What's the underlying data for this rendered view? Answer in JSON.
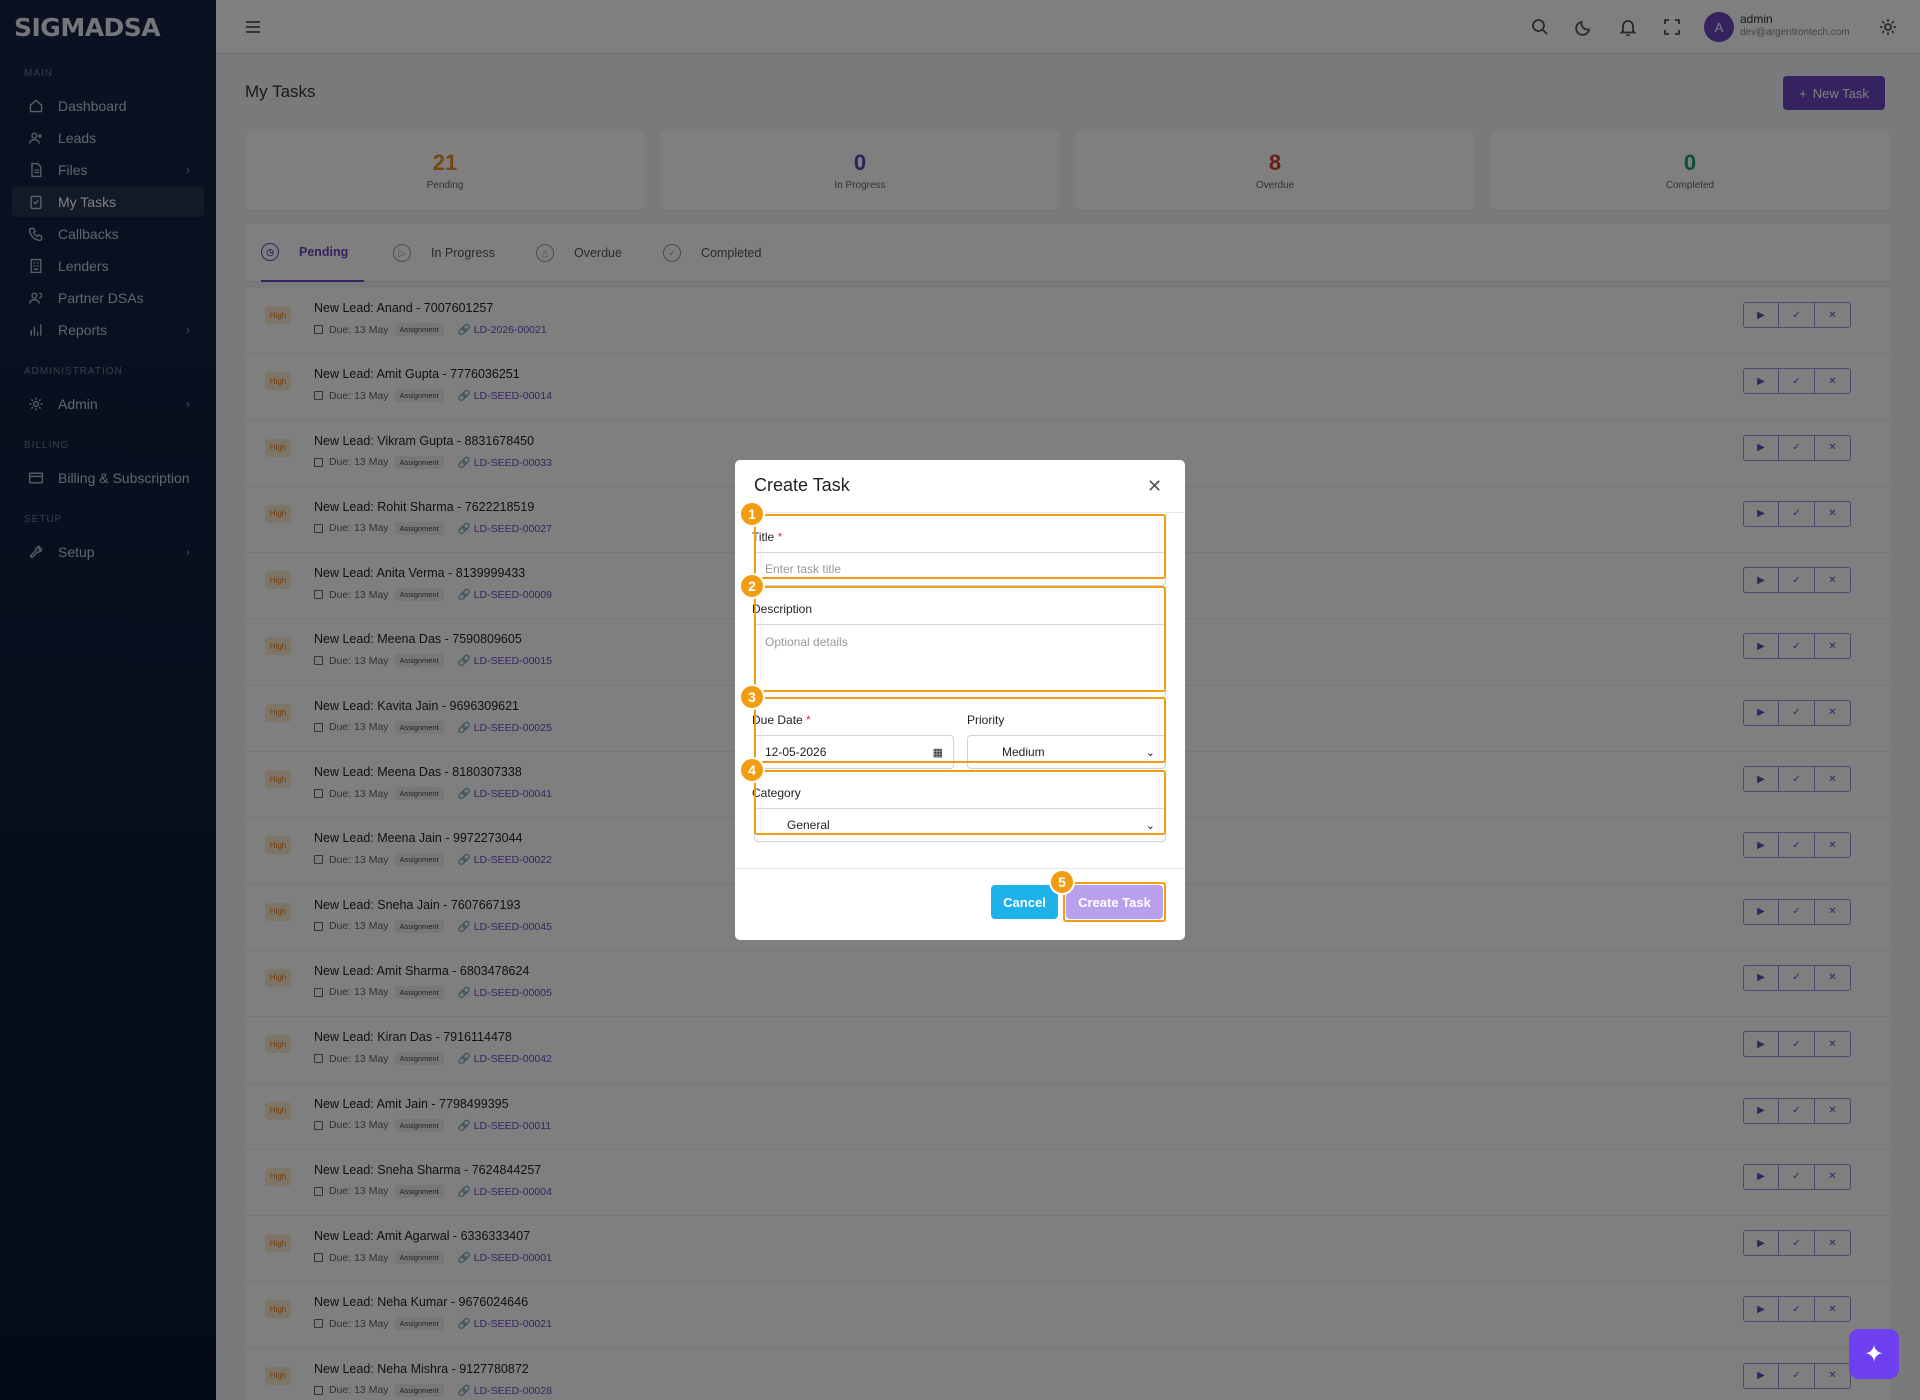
{
  "brand": {
    "logo": "SIGMADSA"
  },
  "sidebar": {
    "sections": [
      {
        "title": "MAIN",
        "items": [
          {
            "label": "Dashboard",
            "icon": "home-icon"
          },
          {
            "label": "Leads",
            "icon": "user-plus-icon"
          },
          {
            "label": "Files",
            "icon": "file-icon",
            "chevron": "›"
          },
          {
            "label": "My Tasks",
            "icon": "task-icon",
            "active": true
          },
          {
            "label": "Callbacks",
            "icon": "phone-icon"
          },
          {
            "label": "Lenders",
            "icon": "building-icon"
          },
          {
            "label": "Partner DSAs",
            "icon": "users-icon"
          },
          {
            "label": "Reports",
            "icon": "bar-chart-icon",
            "chevron": "›"
          }
        ]
      },
      {
        "title": "ADMINISTRATION",
        "items": [
          {
            "label": "Admin",
            "icon": "gear-icon",
            "chevron": "›"
          }
        ]
      },
      {
        "title": "BILLING",
        "items": [
          {
            "label": "Billing & Subscription",
            "icon": "credit-card-icon"
          }
        ]
      },
      {
        "title": "SETUP",
        "items": [
          {
            "label": "Setup",
            "icon": "wrench-icon",
            "chevron": "›"
          }
        ]
      }
    ]
  },
  "topbar": {
    "user_initial": "A",
    "user_name": "admin",
    "user_email": "dev@argentrontech.com"
  },
  "page": {
    "title": "My Tasks",
    "new_task_label": "New Task"
  },
  "stats": [
    {
      "value": "21",
      "label": "Pending",
      "color": "#e8912a"
    },
    {
      "value": "0",
      "label": "In Progress",
      "color": "#5a3fb8"
    },
    {
      "value": "8",
      "label": "Overdue",
      "color": "#d33a2c"
    },
    {
      "value": "0",
      "label": "Completed",
      "color": "#1f9d6b"
    }
  ],
  "tabs": [
    {
      "label": "Pending",
      "active": true
    },
    {
      "label": "In Progress"
    },
    {
      "label": "Overdue"
    },
    {
      "label": "Completed"
    }
  ],
  "tasks": [
    {
      "priority": "High",
      "title": "New Lead: Anand - 7007601257",
      "due": "Due: 13 May",
      "type": "Assignment",
      "ref": "LD-2026-00021"
    },
    {
      "priority": "High",
      "title": "New Lead: Amit Gupta - 7776036251",
      "due": "Due: 13 May",
      "type": "Assignment",
      "ref": "LD-SEED-00014"
    },
    {
      "priority": "High",
      "title": "New Lead: Vikram Gupta - 8831678450",
      "due": "Due: 13 May",
      "type": "Assignment",
      "ref": "LD-SEED-00033"
    },
    {
      "priority": "High",
      "title": "New Lead: Rohit Sharma - 7622218519",
      "due": "Due: 13 May",
      "type": "Assignment",
      "ref": "LD-SEED-00027"
    },
    {
      "priority": "High",
      "title": "New Lead: Anita Verma - 8139999433",
      "due": "Due: 13 May",
      "type": "Assignment",
      "ref": "LD-SEED-00009"
    },
    {
      "priority": "High",
      "title": "New Lead: Meena Das - 7590809605",
      "due": "Due: 13 May",
      "type": "Assignment",
      "ref": "LD-SEED-00015"
    },
    {
      "priority": "High",
      "title": "New Lead: Kavita Jain - 9696309621",
      "due": "Due: 13 May",
      "type": "Assignment",
      "ref": "LD-SEED-00025"
    },
    {
      "priority": "High",
      "title": "New Lead: Meena Das - 8180307338",
      "due": "Due: 13 May",
      "type": "Assignment",
      "ref": "LD-SEED-00041"
    },
    {
      "priority": "High",
      "title": "New Lead: Meena Jain - 9972273044",
      "due": "Due: 13 May",
      "type": "Assignment",
      "ref": "LD-SEED-00022"
    },
    {
      "priority": "High",
      "title": "New Lead: Sneha Jain - 7607667193",
      "due": "Due: 13 May",
      "type": "Assignment",
      "ref": "LD-SEED-00045"
    },
    {
      "priority": "High",
      "title": "New Lead: Amit Sharma - 6803478624",
      "due": "Due: 13 May",
      "type": "Assignment",
      "ref": "LD-SEED-00005"
    },
    {
      "priority": "High",
      "title": "New Lead: Kiran Das - 7916114478",
      "due": "Due: 13 May",
      "type": "Assignment",
      "ref": "LD-SEED-00042"
    },
    {
      "priority": "High",
      "title": "New Lead: Amit Jain - 7798499395",
      "due": "Due: 13 May",
      "type": "Assignment",
      "ref": "LD-SEED-00011"
    },
    {
      "priority": "High",
      "title": "New Lead: Sneha Sharma - 7624844257",
      "due": "Due: 13 May",
      "type": "Assignment",
      "ref": "LD-SEED-00004"
    },
    {
      "priority": "High",
      "title": "New Lead: Amit Agarwal - 6336333407",
      "due": "Due: 13 May",
      "type": "Assignment",
      "ref": "LD-SEED-00001"
    },
    {
      "priority": "High",
      "title": "New Lead: Neha Kumar - 9676024646",
      "due": "Due: 13 May",
      "type": "Assignment",
      "ref": "LD-SEED-00021"
    },
    {
      "priority": "High",
      "title": "New Lead: Neha Mishra - 9127780872",
      "due": "Due: 13 May",
      "type": "Assignment",
      "ref": "LD-SEED-00028"
    }
  ],
  "row_actions": [
    {
      "icon": "play-icon",
      "glyph": "▶"
    },
    {
      "icon": "check-icon",
      "glyph": "✓"
    },
    {
      "icon": "close-icon",
      "glyph": "✕"
    }
  ],
  "modal": {
    "title": "Create Task",
    "close_glyph": "✕",
    "title_label": "Title",
    "required_mark": "*",
    "title_placeholder": "Enter task title",
    "description_label": "Description",
    "description_placeholder": "Optional details",
    "due_date_label": "Due Date",
    "due_date_value": "12-05-2026",
    "priority_label": "Priority",
    "priority_value": "Medium",
    "category_label": "Category",
    "category_value": "General",
    "cancel_label": "Cancel",
    "create_label": "Create Task",
    "markers": [
      "1",
      "2",
      "3",
      "4",
      "5"
    ]
  },
  "fab": {
    "icon": "sparkle-icon",
    "glyph": "✦"
  }
}
